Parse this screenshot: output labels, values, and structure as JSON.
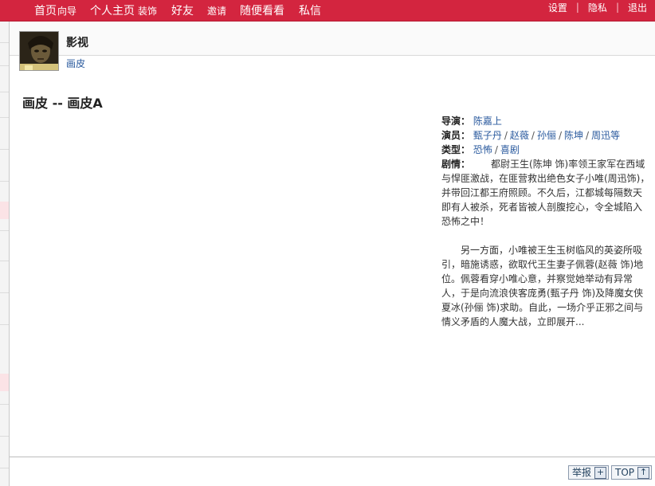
{
  "nav": {
    "items": [
      "首页",
      "向导",
      "个人主页",
      "装饰",
      "好友",
      "邀请",
      "随便看看",
      "私信"
    ],
    "right": [
      "设置",
      "隐私",
      "退出"
    ]
  },
  "profile": {
    "name": "影视",
    "category": "画皮"
  },
  "article": {
    "title": "画皮 -- 画皮A",
    "director_label": "导演：",
    "director": "陈嘉上",
    "cast_label": "演员：",
    "cast": [
      "甄子丹",
      "赵薇",
      "孙俪",
      "陈坤",
      "周迅等"
    ],
    "genre_label": "类型：",
    "genre": [
      "恐怖",
      "喜剧"
    ],
    "plot_label": "剧情：",
    "plot_1": "都尉王生(陈坤 饰)率领王家军在西域与悍匪激战，在匪营救出绝色女子小唯(周迅饰)，并带回江都王府照顾。不久后，江都城每隔数天即有人被杀，死者皆被人剖腹挖心，令全城陷入恐怖之中！",
    "plot_2": "另一方面，小唯被王生玉树临风的英姿所吸引，暗施诱惑，欲取代王生妻子佩蓉(赵薇 饰)地位。佩蓉看穿小唯心意，并察觉她举动有异常人，于是向流浪侠客庞勇(甄子丹 饰)及降魔女侠夏冰(孙俪 饰)求助。自此，一场介乎正邪之间与情义矛盾的人魔大战，立即展开..."
  },
  "footer": {
    "report": "举报",
    "report_icon": "+",
    "top": "TOP",
    "top_icon": "↑"
  },
  "colors": {
    "nav_bg": "#d3253f",
    "link": "#2a5a9e"
  }
}
